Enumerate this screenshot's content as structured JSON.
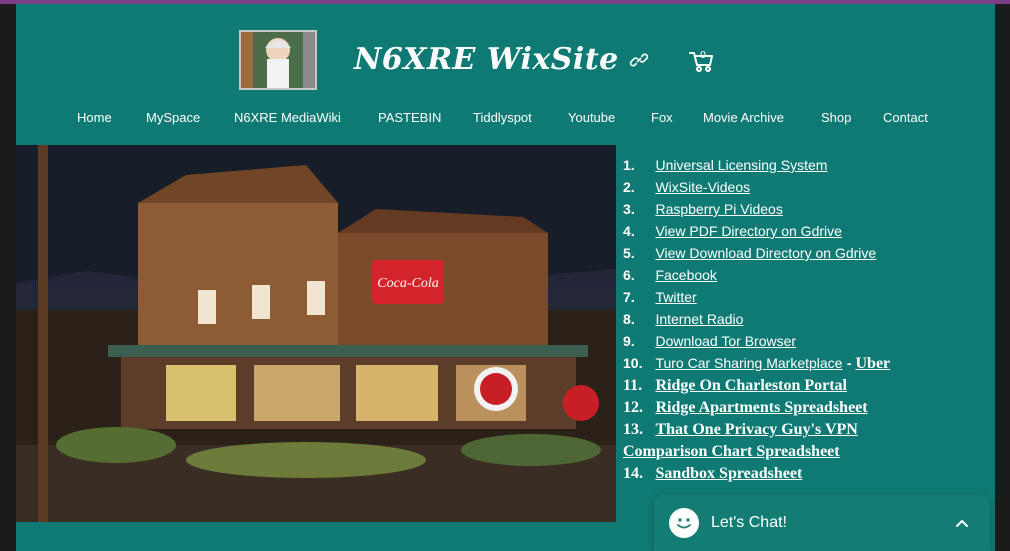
{
  "site": {
    "title": "N6XRE WixSite",
    "cart_count": "0"
  },
  "nav": {
    "items": [
      "Home",
      "MySpace",
      "N6XRE MediaWiki",
      "PASTEBIN",
      "Tiddlyspot",
      "Youtube",
      "Fox",
      "Movie Archive",
      "Shop",
      "Contact"
    ]
  },
  "links": {
    "items": [
      {
        "num": "1.",
        "label": "Universal Licensing System"
      },
      {
        "num": "2.",
        "label": "WixSite-Videos"
      },
      {
        "num": "3.",
        "label": "Raspberry Pi Videos"
      },
      {
        "num": "4.",
        "label": "View PDF Directory on Gdrive"
      },
      {
        "num": "5.",
        "label": "View Download Directory on Gdrive"
      },
      {
        "num": "6.",
        "label": "Facebook"
      },
      {
        "num": "7.",
        "label": "Twitter"
      },
      {
        "num": "8.",
        "label": "Internet Radio"
      },
      {
        "num": "9.",
        "label": "Download Tor Browser"
      },
      {
        "num": "10.",
        "label": "Turo Car Sharing Marketplace",
        "extra": "Uber"
      },
      {
        "num": "11.",
        "label": "Ridge On Charleston Portal"
      },
      {
        "num": "12.",
        "label": "Ridge Apartments Spreadsheet"
      },
      {
        "num": "13.",
        "label": "That One Privacy Guy's VPN",
        "second_line": "Comparison Chart Spreadsheet"
      },
      {
        "num": "14.",
        "label": "Sandbox Spreadsheet"
      }
    ]
  },
  "chat": {
    "label": "Let's Chat!"
  }
}
